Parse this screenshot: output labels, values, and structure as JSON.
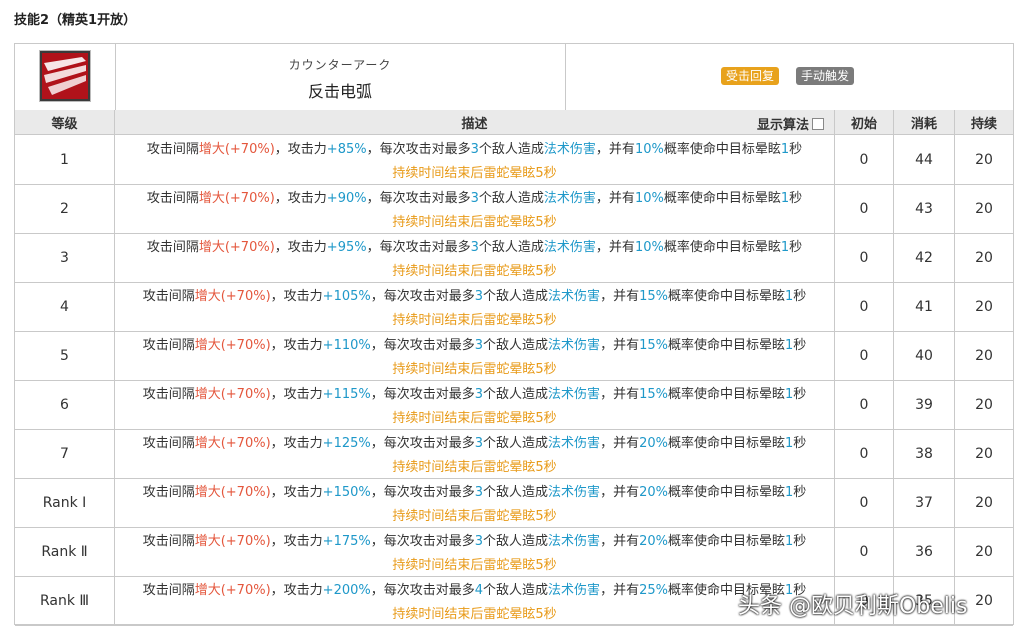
{
  "page_title": "技能2（精英1开放）",
  "skill": {
    "name_jp": "カウンターアーク",
    "name_cn": "反击电弧",
    "tags": [
      {
        "label": "受击回复",
        "color": "#e8a21c"
      },
      {
        "label": "手动触发",
        "color": "#7b7b7b"
      }
    ]
  },
  "table": {
    "headers": {
      "level": "等级",
      "desc": "描述",
      "algo": "显示算法",
      "init": "初始",
      "cost": "消耗",
      "duration": "持续"
    },
    "rows": [
      {
        "level": "1",
        "d_a": "攻击间隔",
        "d_b": "增大(+70%)",
        "d_c": "，攻击力",
        "d_d": "+85%",
        "d_e": "，每次攻击对最多",
        "d_f": "3",
        "d_g": "个敌人造成",
        "d_h": "法术伤害",
        "d_i": "，并有",
        "d_j": "10%",
        "d_k": "概率使命中目标晕眩",
        "d_l": "1",
        "d_m": "秒",
        "line2": "持续时间结束后雷蛇晕眩5秒",
        "init": "0",
        "cost": "44",
        "duration": "20"
      },
      {
        "level": "2",
        "d_a": "攻击间隔",
        "d_b": "增大(+70%)",
        "d_c": "，攻击力",
        "d_d": "+90%",
        "d_e": "，每次攻击对最多",
        "d_f": "3",
        "d_g": "个敌人造成",
        "d_h": "法术伤害",
        "d_i": "，并有",
        "d_j": "10%",
        "d_k": "概率使命中目标晕眩",
        "d_l": "1",
        "d_m": "秒",
        "line2": "持续时间结束后雷蛇晕眩5秒",
        "init": "0",
        "cost": "43",
        "duration": "20"
      },
      {
        "level": "3",
        "d_a": "攻击间隔",
        "d_b": "增大(+70%)",
        "d_c": "，攻击力",
        "d_d": "+95%",
        "d_e": "，每次攻击对最多",
        "d_f": "3",
        "d_g": "个敌人造成",
        "d_h": "法术伤害",
        "d_i": "，并有",
        "d_j": "10%",
        "d_k": "概率使命中目标晕眩",
        "d_l": "1",
        "d_m": "秒",
        "line2": "持续时间结束后雷蛇晕眩5秒",
        "init": "0",
        "cost": "42",
        "duration": "20"
      },
      {
        "level": "4",
        "d_a": "攻击间隔",
        "d_b": "增大(+70%)",
        "d_c": "，攻击力",
        "d_d": "+105%",
        "d_e": "，每次攻击对最多",
        "d_f": "3",
        "d_g": "个敌人造成",
        "d_h": "法术伤害",
        "d_i": "，并有",
        "d_j": "15%",
        "d_k": "概率使命中目标晕眩",
        "d_l": "1",
        "d_m": "秒",
        "line2": "持续时间结束后雷蛇晕眩5秒",
        "init": "0",
        "cost": "41",
        "duration": "20"
      },
      {
        "level": "5",
        "d_a": "攻击间隔",
        "d_b": "增大(+70%)",
        "d_c": "，攻击力",
        "d_d": "+110%",
        "d_e": "，每次攻击对最多",
        "d_f": "3",
        "d_g": "个敌人造成",
        "d_h": "法术伤害",
        "d_i": "，并有",
        "d_j": "15%",
        "d_k": "概率使命中目标晕眩",
        "d_l": "1",
        "d_m": "秒",
        "line2": "持续时间结束后雷蛇晕眩5秒",
        "init": "0",
        "cost": "40",
        "duration": "20"
      },
      {
        "level": "6",
        "d_a": "攻击间隔",
        "d_b": "增大(+70%)",
        "d_c": "，攻击力",
        "d_d": "+115%",
        "d_e": "，每次攻击对最多",
        "d_f": "3",
        "d_g": "个敌人造成",
        "d_h": "法术伤害",
        "d_i": "，并有",
        "d_j": "15%",
        "d_k": "概率使命中目标晕眩",
        "d_l": "1",
        "d_m": "秒",
        "line2": "持续时间结束后雷蛇晕眩5秒",
        "init": "0",
        "cost": "39",
        "duration": "20"
      },
      {
        "level": "7",
        "d_a": "攻击间隔",
        "d_b": "增大(+70%)",
        "d_c": "，攻击力",
        "d_d": "+125%",
        "d_e": "，每次攻击对最多",
        "d_f": "3",
        "d_g": "个敌人造成",
        "d_h": "法术伤害",
        "d_i": "，并有",
        "d_j": "20%",
        "d_k": "概率使命中目标晕眩",
        "d_l": "1",
        "d_m": "秒",
        "line2": "持续时间结束后雷蛇晕眩5秒",
        "init": "0",
        "cost": "38",
        "duration": "20"
      },
      {
        "level": "Rank Ⅰ",
        "d_a": "攻击间隔",
        "d_b": "增大(+70%)",
        "d_c": "，攻击力",
        "d_d": "+150%",
        "d_e": "，每次攻击对最多",
        "d_f": "3",
        "d_g": "个敌人造成",
        "d_h": "法术伤害",
        "d_i": "，并有",
        "d_j": "20%",
        "d_k": "概率使命中目标晕眩",
        "d_l": "1",
        "d_m": "秒",
        "line2": "持续时间结束后雷蛇晕眩5秒",
        "init": "0",
        "cost": "37",
        "duration": "20"
      },
      {
        "level": "Rank Ⅱ",
        "d_a": "攻击间隔",
        "d_b": "增大(+70%)",
        "d_c": "，攻击力",
        "d_d": "+175%",
        "d_e": "，每次攻击对最多",
        "d_f": "3",
        "d_g": "个敌人造成",
        "d_h": "法术伤害",
        "d_i": "，并有",
        "d_j": "20%",
        "d_k": "概率使命中目标晕眩",
        "d_l": "1",
        "d_m": "秒",
        "line2": "持续时间结束后雷蛇晕眩5秒",
        "init": "0",
        "cost": "36",
        "duration": "20"
      },
      {
        "level": "Rank Ⅲ",
        "d_a": "攻击间隔",
        "d_b": "增大(+70%)",
        "d_c": "，攻击力",
        "d_d": "+200%",
        "d_e": "，每次攻击对最多",
        "d_f": "4",
        "d_g": "个敌人造成",
        "d_h": "法术伤害",
        "d_i": "，并有",
        "d_j": "25%",
        "d_k": "概率使命中目标晕眩",
        "d_l": "1",
        "d_m": "秒",
        "line2": "持续时间结束后雷蛇晕眩5秒",
        "init": "0",
        "cost": "35",
        "duration": "20"
      }
    ]
  },
  "watermark": "头条 @欧贝利斯Obelis"
}
